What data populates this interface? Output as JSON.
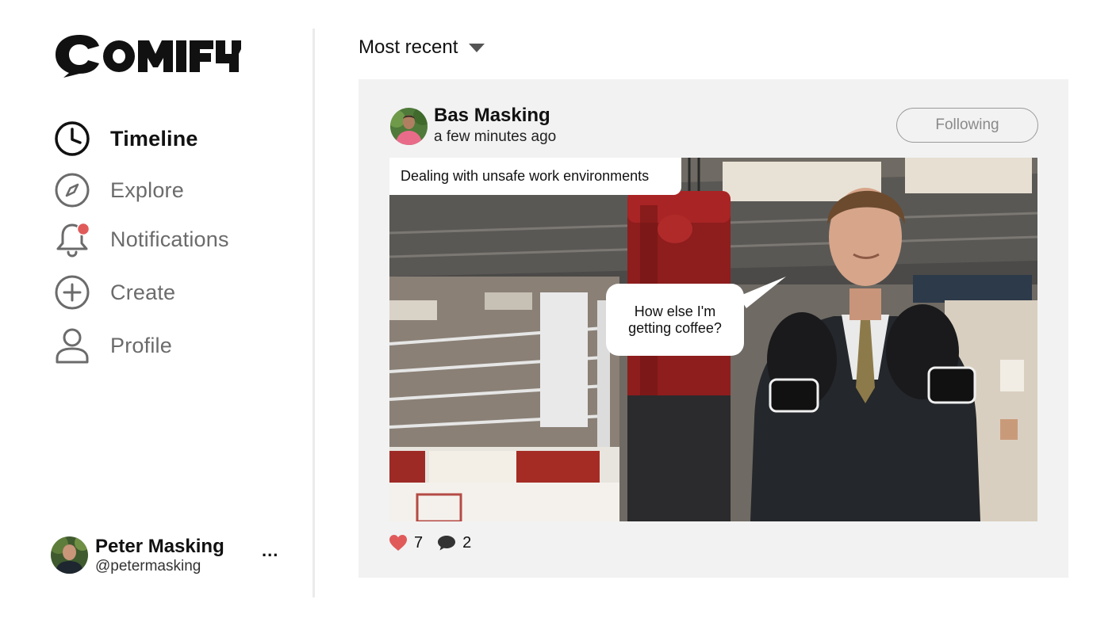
{
  "app": {
    "logo_text": "COMIFY"
  },
  "sidebar": {
    "items": [
      {
        "label": "Timeline",
        "icon": "clock-icon",
        "active": true
      },
      {
        "label": "Explore",
        "icon": "compass-icon",
        "active": false
      },
      {
        "label": "Notifications",
        "icon": "bell-icon",
        "active": false,
        "has_unread_dot": true
      },
      {
        "label": "Create",
        "icon": "plus-circle-icon",
        "active": false
      },
      {
        "label": "Profile",
        "icon": "person-icon",
        "active": false
      }
    ]
  },
  "current_user": {
    "name": "Peter Masking",
    "handle": "@petermasking",
    "more": "..."
  },
  "feed": {
    "sort_label": "Most recent",
    "post": {
      "author": "Bas Masking",
      "time": "a few minutes ago",
      "follow_label": "Following",
      "caption": "Dealing with unsafe work environments",
      "bubble": "How else I'm getting coffee?",
      "likes": "7",
      "comments": "2"
    }
  },
  "colors": {
    "accent_red": "#e05a5a",
    "feed_bg": "#f2f2f2",
    "muted_text": "#6b6b6b"
  }
}
